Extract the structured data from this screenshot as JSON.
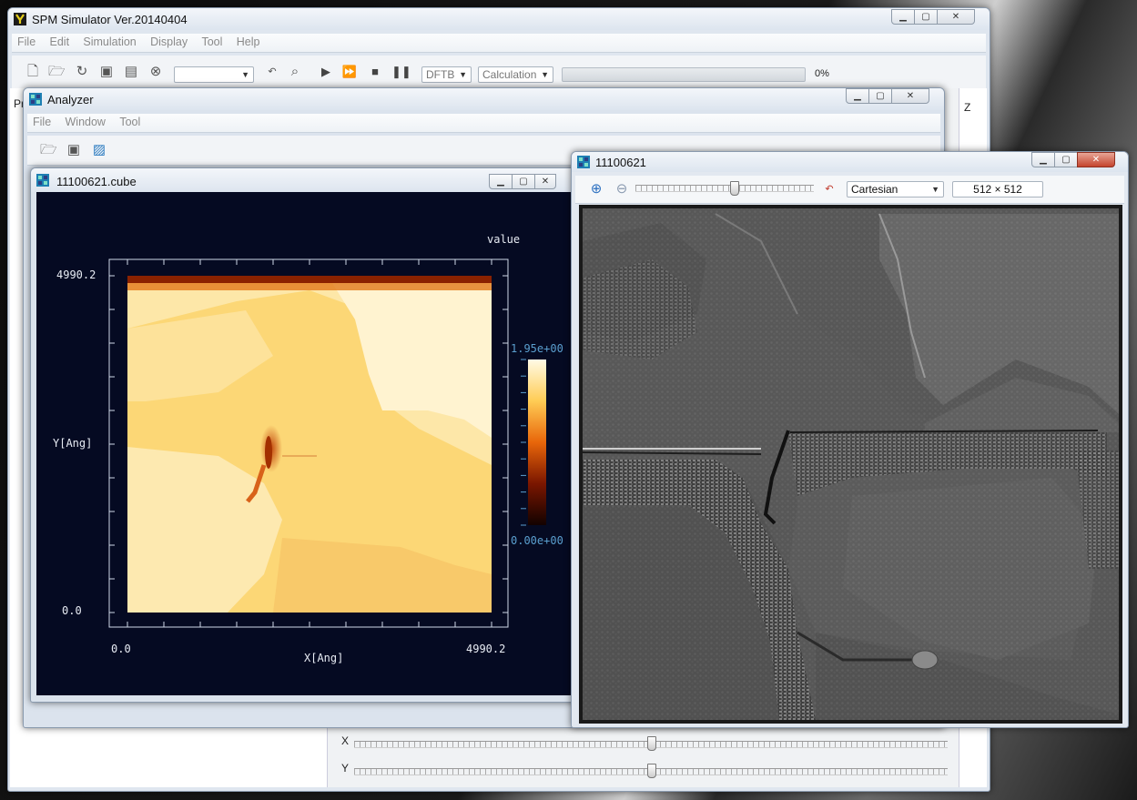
{
  "main": {
    "title": "SPM Simulator Ver.20140404",
    "menu": [
      "File",
      "Edit",
      "Simulation",
      "Display",
      "Tool",
      "Help"
    ],
    "method_combo": "DFTB",
    "mode_combo": "Calculation",
    "progress_text": "0%",
    "progress": 0,
    "side_label": "Pr",
    "z_label": "Z",
    "x_label": "X",
    "y_label": "Y",
    "x_slider": 0.5,
    "y_slider": 0.5
  },
  "analyzer": {
    "title": "Analyzer",
    "menu": [
      "File",
      "Window",
      "Tool"
    ]
  },
  "cube": {
    "title": "11100621.cube",
    "value_label": "value",
    "ymax_label": "4990.2",
    "ymin_label": "0.0",
    "xmin_label": "0.0",
    "xmax_label": "4990.2",
    "ylabel": "Y[Ang]",
    "xlabel": "X[Ang]",
    "cbar_max": "1.95e+00",
    "cbar_min": "0.00e+00"
  },
  "image": {
    "title": "11100621",
    "projection": "Cartesian",
    "size_text": "512 × 512",
    "zoom_slider": 0.55
  },
  "colors": {
    "plot_bg": "#050a22",
    "axis_label": "#5a9fcf",
    "hot_light": "#fff7cf",
    "hot_dark": "#3a0a00"
  }
}
